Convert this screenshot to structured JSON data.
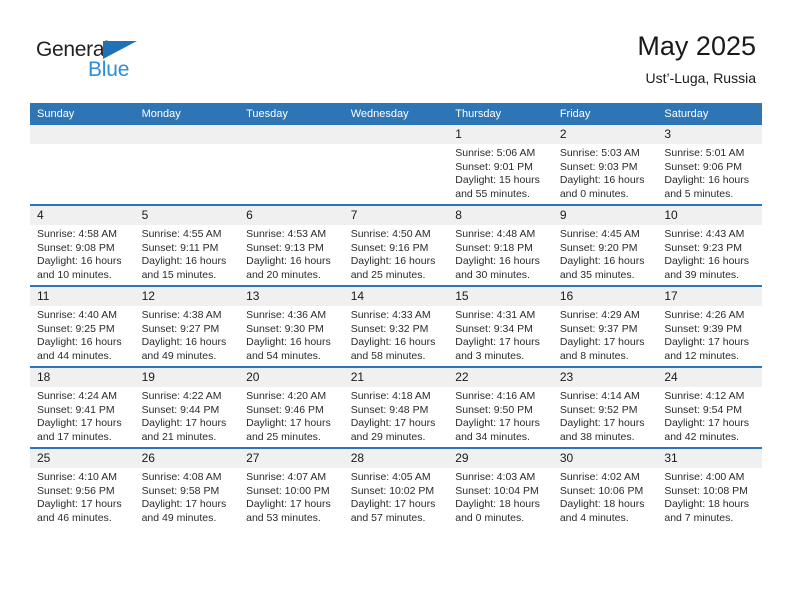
{
  "brand": {
    "name_dark": "General",
    "name_blue": "Blue",
    "triangle_icon": "logo-triangle"
  },
  "header": {
    "title": "May 2025",
    "subtitle": "Ust’-Luga, Russia"
  },
  "colors": {
    "header_blue": "#2e75b6",
    "brand_blue": "#2b8fd6",
    "daynum_band": "#f0f0f0",
    "text": "#1a1a1a"
  },
  "weekday_headers": [
    "Sunday",
    "Monday",
    "Tuesday",
    "Wednesday",
    "Thursday",
    "Friday",
    "Saturday"
  ],
  "weeks": [
    [
      {
        "day": "",
        "empty": true,
        "lines": []
      },
      {
        "day": "",
        "empty": true,
        "lines": []
      },
      {
        "day": "",
        "empty": true,
        "lines": []
      },
      {
        "day": "",
        "empty": true,
        "lines": []
      },
      {
        "day": "1",
        "empty": false,
        "lines": [
          "Sunrise: 5:06 AM",
          "Sunset: 9:01 PM",
          "Daylight: 15 hours",
          "and 55 minutes."
        ]
      },
      {
        "day": "2",
        "empty": false,
        "lines": [
          "Sunrise: 5:03 AM",
          "Sunset: 9:03 PM",
          "Daylight: 16 hours",
          "and 0 minutes."
        ]
      },
      {
        "day": "3",
        "empty": false,
        "lines": [
          "Sunrise: 5:01 AM",
          "Sunset: 9:06 PM",
          "Daylight: 16 hours",
          "and 5 minutes."
        ]
      }
    ],
    [
      {
        "day": "4",
        "empty": false,
        "lines": [
          "Sunrise: 4:58 AM",
          "Sunset: 9:08 PM",
          "Daylight: 16 hours",
          "and 10 minutes."
        ]
      },
      {
        "day": "5",
        "empty": false,
        "lines": [
          "Sunrise: 4:55 AM",
          "Sunset: 9:11 PM",
          "Daylight: 16 hours",
          "and 15 minutes."
        ]
      },
      {
        "day": "6",
        "empty": false,
        "lines": [
          "Sunrise: 4:53 AM",
          "Sunset: 9:13 PM",
          "Daylight: 16 hours",
          "and 20 minutes."
        ]
      },
      {
        "day": "7",
        "empty": false,
        "lines": [
          "Sunrise: 4:50 AM",
          "Sunset: 9:16 PM",
          "Daylight: 16 hours",
          "and 25 minutes."
        ]
      },
      {
        "day": "8",
        "empty": false,
        "lines": [
          "Sunrise: 4:48 AM",
          "Sunset: 9:18 PM",
          "Daylight: 16 hours",
          "and 30 minutes."
        ]
      },
      {
        "day": "9",
        "empty": false,
        "lines": [
          "Sunrise: 4:45 AM",
          "Sunset: 9:20 PM",
          "Daylight: 16 hours",
          "and 35 minutes."
        ]
      },
      {
        "day": "10",
        "empty": false,
        "lines": [
          "Sunrise: 4:43 AM",
          "Sunset: 9:23 PM",
          "Daylight: 16 hours",
          "and 39 minutes."
        ]
      }
    ],
    [
      {
        "day": "11",
        "empty": false,
        "lines": [
          "Sunrise: 4:40 AM",
          "Sunset: 9:25 PM",
          "Daylight: 16 hours",
          "and 44 minutes."
        ]
      },
      {
        "day": "12",
        "empty": false,
        "lines": [
          "Sunrise: 4:38 AM",
          "Sunset: 9:27 PM",
          "Daylight: 16 hours",
          "and 49 minutes."
        ]
      },
      {
        "day": "13",
        "empty": false,
        "lines": [
          "Sunrise: 4:36 AM",
          "Sunset: 9:30 PM",
          "Daylight: 16 hours",
          "and 54 minutes."
        ]
      },
      {
        "day": "14",
        "empty": false,
        "lines": [
          "Sunrise: 4:33 AM",
          "Sunset: 9:32 PM",
          "Daylight: 16 hours",
          "and 58 minutes."
        ]
      },
      {
        "day": "15",
        "empty": false,
        "lines": [
          "Sunrise: 4:31 AM",
          "Sunset: 9:34 PM",
          "Daylight: 17 hours",
          "and 3 minutes."
        ]
      },
      {
        "day": "16",
        "empty": false,
        "lines": [
          "Sunrise: 4:29 AM",
          "Sunset: 9:37 PM",
          "Daylight: 17 hours",
          "and 8 minutes."
        ]
      },
      {
        "day": "17",
        "empty": false,
        "lines": [
          "Sunrise: 4:26 AM",
          "Sunset: 9:39 PM",
          "Daylight: 17 hours",
          "and 12 minutes."
        ]
      }
    ],
    [
      {
        "day": "18",
        "empty": false,
        "lines": [
          "Sunrise: 4:24 AM",
          "Sunset: 9:41 PM",
          "Daylight: 17 hours",
          "and 17 minutes."
        ]
      },
      {
        "day": "19",
        "empty": false,
        "lines": [
          "Sunrise: 4:22 AM",
          "Sunset: 9:44 PM",
          "Daylight: 17 hours",
          "and 21 minutes."
        ]
      },
      {
        "day": "20",
        "empty": false,
        "lines": [
          "Sunrise: 4:20 AM",
          "Sunset: 9:46 PM",
          "Daylight: 17 hours",
          "and 25 minutes."
        ]
      },
      {
        "day": "21",
        "empty": false,
        "lines": [
          "Sunrise: 4:18 AM",
          "Sunset: 9:48 PM",
          "Daylight: 17 hours",
          "and 29 minutes."
        ]
      },
      {
        "day": "22",
        "empty": false,
        "lines": [
          "Sunrise: 4:16 AM",
          "Sunset: 9:50 PM",
          "Daylight: 17 hours",
          "and 34 minutes."
        ]
      },
      {
        "day": "23",
        "empty": false,
        "lines": [
          "Sunrise: 4:14 AM",
          "Sunset: 9:52 PM",
          "Daylight: 17 hours",
          "and 38 minutes."
        ]
      },
      {
        "day": "24",
        "empty": false,
        "lines": [
          "Sunrise: 4:12 AM",
          "Sunset: 9:54 PM",
          "Daylight: 17 hours",
          "and 42 minutes."
        ]
      }
    ],
    [
      {
        "day": "25",
        "empty": false,
        "lines": [
          "Sunrise: 4:10 AM",
          "Sunset: 9:56 PM",
          "Daylight: 17 hours",
          "and 46 minutes."
        ]
      },
      {
        "day": "26",
        "empty": false,
        "lines": [
          "Sunrise: 4:08 AM",
          "Sunset: 9:58 PM",
          "Daylight: 17 hours",
          "and 49 minutes."
        ]
      },
      {
        "day": "27",
        "empty": false,
        "lines": [
          "Sunrise: 4:07 AM",
          "Sunset: 10:00 PM",
          "Daylight: 17 hours",
          "and 53 minutes."
        ]
      },
      {
        "day": "28",
        "empty": false,
        "lines": [
          "Sunrise: 4:05 AM",
          "Sunset: 10:02 PM",
          "Daylight: 17 hours",
          "and 57 minutes."
        ]
      },
      {
        "day": "29",
        "empty": false,
        "lines": [
          "Sunrise: 4:03 AM",
          "Sunset: 10:04 PM",
          "Daylight: 18 hours",
          "and 0 minutes."
        ]
      },
      {
        "day": "30",
        "empty": false,
        "lines": [
          "Sunrise: 4:02 AM",
          "Sunset: 10:06 PM",
          "Daylight: 18 hours",
          "and 4 minutes."
        ]
      },
      {
        "day": "31",
        "empty": false,
        "lines": [
          "Sunrise: 4:00 AM",
          "Sunset: 10:08 PM",
          "Daylight: 18 hours",
          "and 7 minutes."
        ]
      }
    ]
  ]
}
